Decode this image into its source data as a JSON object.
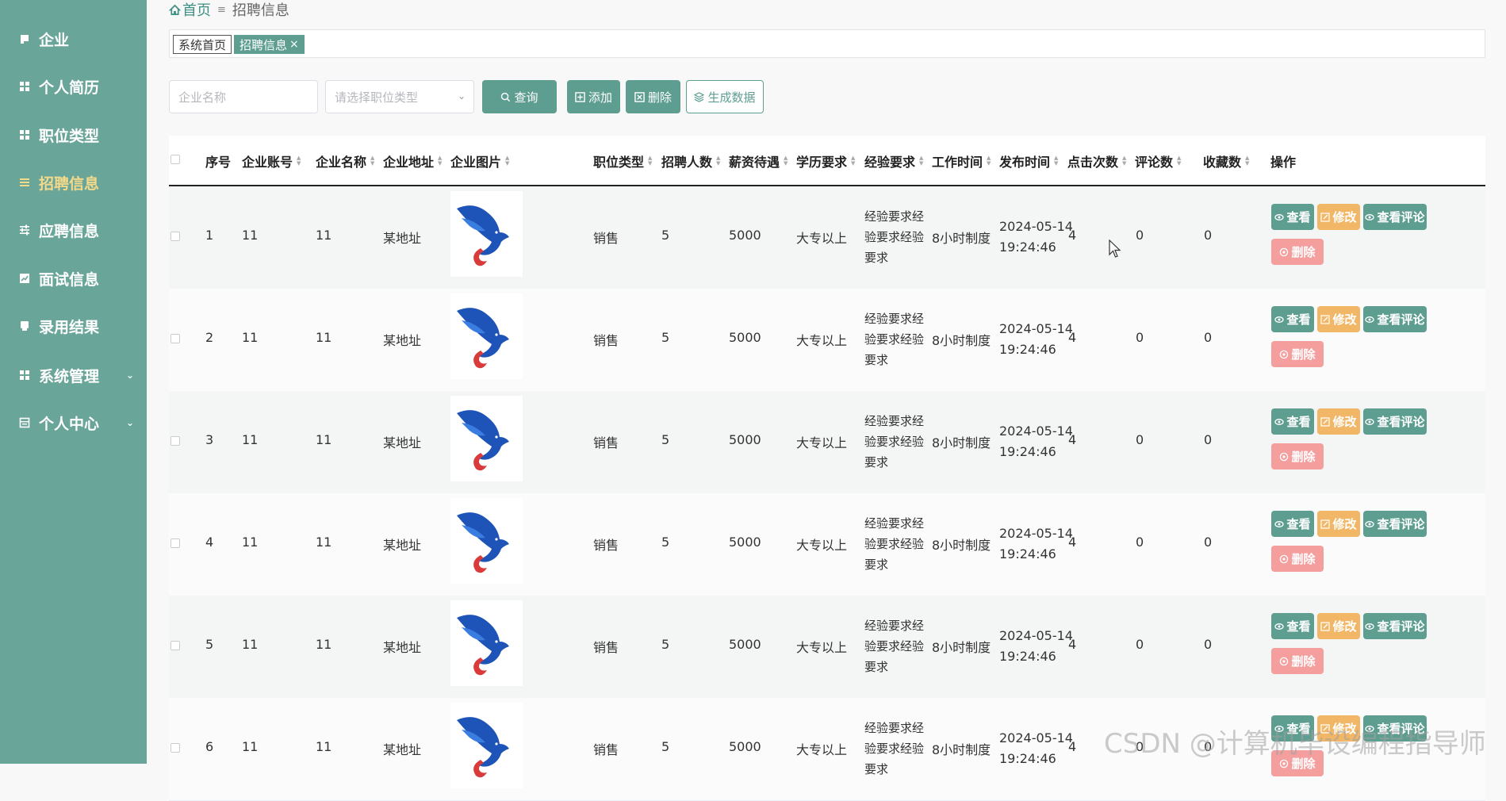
{
  "sidebar": {
    "items": [
      {
        "label": "企业",
        "icon": "square-icon"
      },
      {
        "label": "个人简历",
        "icon": "grid-icon"
      },
      {
        "label": "职位类型",
        "icon": "grid-icon"
      },
      {
        "label": "招聘信息",
        "icon": "list-icon",
        "active": true
      },
      {
        "label": "应聘信息",
        "icon": "sliders-icon"
      },
      {
        "label": "面试信息",
        "icon": "chart-icon"
      },
      {
        "label": "录用结果",
        "icon": "tag-icon"
      },
      {
        "label": "系统管理",
        "icon": "grid-icon",
        "expandable": true
      },
      {
        "label": "个人中心",
        "icon": "window-icon",
        "expandable": true
      }
    ]
  },
  "breadcrumb": {
    "home": "首页",
    "separator": "≡",
    "current": "招聘信息"
  },
  "tabs": [
    {
      "label": "系统首页"
    },
    {
      "label": "招聘信息",
      "close": "×"
    }
  ],
  "filters": {
    "company_placeholder": "企业名称",
    "type_placeholder": "请选择职位类型",
    "search_label": "查询",
    "add_label": "添加",
    "delete_label": "删除",
    "generate_label": "生成数据"
  },
  "table": {
    "headers": {
      "index": "序号",
      "account": "企业账号",
      "name": "企业名称",
      "address": "企业地址",
      "image": "企业图片",
      "type": "职位类型",
      "count": "招聘人数",
      "salary": "薪资待遇",
      "education": "学历要求",
      "experience": "经验要求",
      "hours": "工作时间",
      "published": "发布时间",
      "clicks": "点击次数",
      "comments": "评论数",
      "favorites": "收藏数",
      "actions": "操作"
    },
    "actions": {
      "view": "查看",
      "edit": "修改",
      "comments": "查看评论",
      "delete": "删除"
    },
    "rows": [
      {
        "index": "1",
        "account": "11",
        "name": "11",
        "address": "某地址",
        "type": "销售",
        "count": "5",
        "salary": "5000",
        "education": "大专以上",
        "experience": "经验要求经验要求经验要求",
        "hours": "8小时制度",
        "date": "2024-05-14",
        "time": "19:24:46",
        "clicks": "4",
        "comments": "0",
        "favorites": "0"
      },
      {
        "index": "2",
        "account": "11",
        "name": "11",
        "address": "某地址",
        "type": "销售",
        "count": "5",
        "salary": "5000",
        "education": "大专以上",
        "experience": "经验要求经验要求经验要求",
        "hours": "8小时制度",
        "date": "2024-05-14",
        "time": "19:24:46",
        "clicks": "4",
        "comments": "0",
        "favorites": "0"
      },
      {
        "index": "3",
        "account": "11",
        "name": "11",
        "address": "某地址",
        "type": "销售",
        "count": "5",
        "salary": "5000",
        "education": "大专以上",
        "experience": "经验要求经验要求经验要求",
        "hours": "8小时制度",
        "date": "2024-05-14",
        "time": "19:24:46",
        "clicks": "4",
        "comments": "0",
        "favorites": "0"
      },
      {
        "index": "4",
        "account": "11",
        "name": "11",
        "address": "某地址",
        "type": "销售",
        "count": "5",
        "salary": "5000",
        "education": "大专以上",
        "experience": "经验要求经验要求经验要求",
        "hours": "8小时制度",
        "date": "2024-05-14",
        "time": "19:24:46",
        "clicks": "4",
        "comments": "0",
        "favorites": "0"
      },
      {
        "index": "5",
        "account": "11",
        "name": "11",
        "address": "某地址",
        "type": "销售",
        "count": "5",
        "salary": "5000",
        "education": "大专以上",
        "experience": "经验要求经验要求经验要求",
        "hours": "8小时制度",
        "date": "2024-05-14",
        "time": "19:24:46",
        "clicks": "4",
        "comments": "0",
        "favorites": "0"
      },
      {
        "index": "6",
        "account": "11",
        "name": "11",
        "address": "某地址",
        "type": "销售",
        "count": "5",
        "salary": "5000",
        "education": "大专以上",
        "experience": "经验要求经验要求经验要求",
        "hours": "8小时制度",
        "date": "2024-05-14",
        "time": "19:24:46",
        "clicks": "4",
        "comments": "0",
        "favorites": "0"
      }
    ]
  },
  "colors": {
    "sidebar": "#6aa59a",
    "primary": "#5d9e91",
    "warning": "#f2b766",
    "danger": "#f49e9e",
    "active_nav": "#f3d98a"
  },
  "watermark": "CSDN @计算机毕设编程指导师"
}
